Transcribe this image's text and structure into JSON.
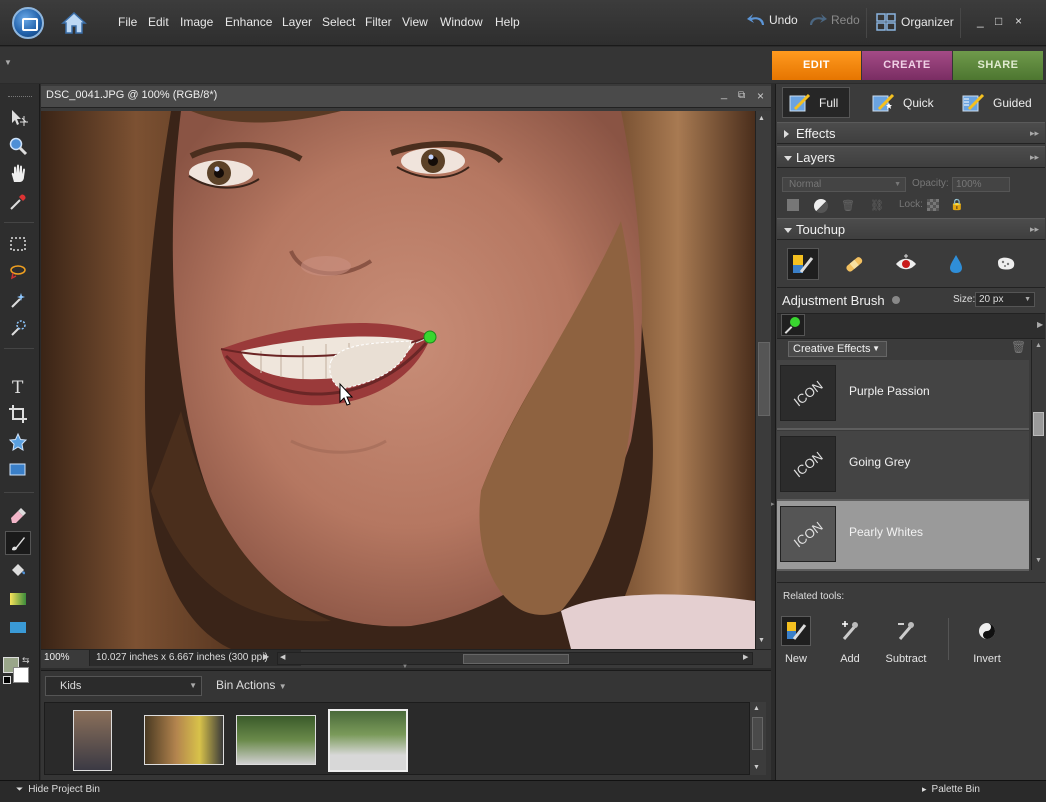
{
  "menubar": {
    "items": [
      "File",
      "Edit",
      "Image",
      "Enhance",
      "Layer",
      "Select",
      "Filter",
      "View",
      "Window",
      "Help"
    ],
    "undo_label": "Undo",
    "redo_label": "Redo",
    "organizer_label": "Organizer",
    "window_controls": [
      "_",
      "□",
      "×"
    ]
  },
  "mode_tabs": {
    "edit": "EDIT",
    "create": "CREATE",
    "share": "SHARE",
    "active": "EDIT"
  },
  "document": {
    "title": "DSC_0041.JPG @ 100% (RGB/8*)",
    "zoom": "100%",
    "doc_info": "10.027 inches x 6.667 inches (300 ppi)"
  },
  "right_panel": {
    "subtabs": {
      "full": "Full",
      "quick": "Quick",
      "guided": "Guided",
      "active": "Full"
    },
    "effects_header": "Effects",
    "layers_header": "Layers",
    "layers": {
      "blend_mode": "Normal",
      "opacity_label": "Opacity:",
      "opacity_value": "100%",
      "lock_label": "Lock:"
    },
    "touchup_header": "Touchup",
    "adjustment_brush": {
      "label": "Adjustment Brush",
      "size_label": "Size:",
      "size_value": "20 px"
    },
    "creative_effects_select": "Creative Effects",
    "effects": [
      {
        "icon_text": "ICON",
        "label": "Purple Passion",
        "selected": false
      },
      {
        "icon_text": "ICON",
        "label": "Going Grey",
        "selected": false
      },
      {
        "icon_text": "ICON",
        "label": "Pearly Whites",
        "selected": true
      }
    ],
    "related_tools_label": "Related tools:",
    "related_tools": [
      "New",
      "Add",
      "Subtract",
      "Invert"
    ]
  },
  "project_bin": {
    "album": "Kids",
    "bin_actions": "Bin Actions"
  },
  "bottom_bar": {
    "hide_project_bin": "Hide Project Bin",
    "palette_bin": "Palette Bin"
  },
  "colors": {
    "edit_tab": "#f08a00",
    "create_tab": "#8e3a74",
    "share_tab": "#5e8a3c",
    "selection_pin": "#39d62f"
  }
}
